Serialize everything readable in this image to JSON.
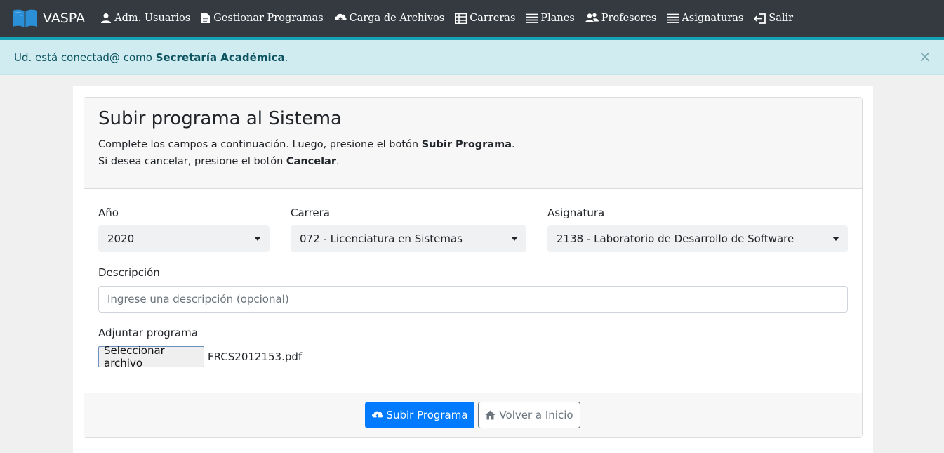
{
  "brand": {
    "name": "VASPA"
  },
  "nav": {
    "items": [
      {
        "label": "Adm. Usuarios",
        "icon": "user-icon"
      },
      {
        "label": "Gestionar Programas",
        "icon": "file-icon"
      },
      {
        "label": "Carga de Archivos",
        "icon": "cloud-upload-icon"
      },
      {
        "label": "Carreras",
        "icon": "table-icon"
      },
      {
        "label": "Planes",
        "icon": "list-icon"
      },
      {
        "label": "Profesores",
        "icon": "users-icon"
      },
      {
        "label": "Asignaturas",
        "icon": "list-icon"
      },
      {
        "label": "Salir",
        "icon": "logout-icon"
      }
    ]
  },
  "alert": {
    "prefix": "Ud. está conectad@ como ",
    "role": "Secretaría Académica",
    "suffix": ".",
    "close": "×"
  },
  "card": {
    "title": "Subir programa al Sistema",
    "line1_prefix": "Complete los campos a continuación. Luego, presione el botón ",
    "line1_bold": "Subir Programa",
    "line1_suffix": ".",
    "line2_prefix": "Si desea cancelar, presione el botón ",
    "line2_bold": "Cancelar",
    "line2_suffix": "."
  },
  "form": {
    "year_label": "Año",
    "year_value": "2020",
    "career_label": "Carrera",
    "career_value": "072 - Licenciatura en Sistemas",
    "subject_label": "Asignatura",
    "subject_value": "2138 - Laboratorio de Desarrollo de Software",
    "description_label": "Descripción",
    "description_placeholder": "Ingrese una descripción (opcional)",
    "attach_label": "Adjuntar programa",
    "file_button": "Seleccionar archivo",
    "file_name": "FRCS2012153.pdf"
  },
  "footer": {
    "submit_label": "Subir Programa",
    "back_label": "Volver a Inicio"
  },
  "colors": {
    "navbar": "#343a40",
    "accent": "#17a2b8",
    "alert_bg": "#d1ecf1",
    "primary": "#007bff"
  }
}
